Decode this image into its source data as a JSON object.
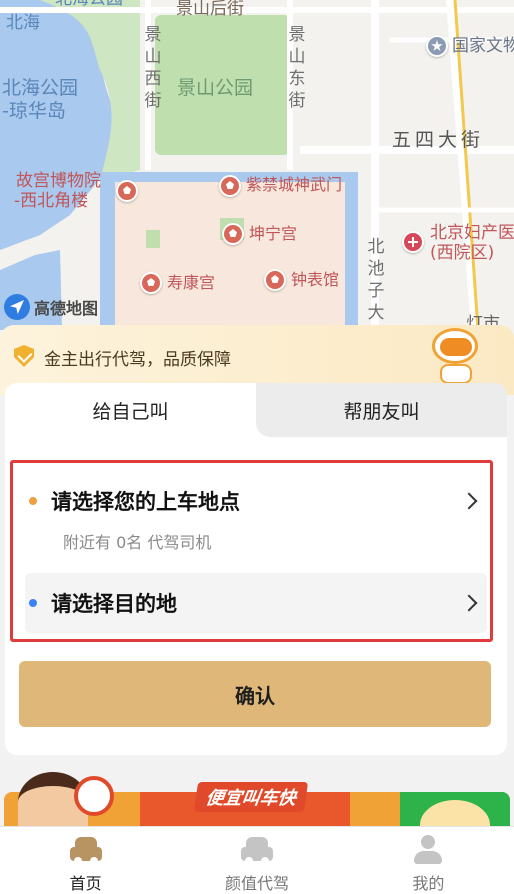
{
  "map": {
    "labels": {
      "beihai_top": "北海公园",
      "beihai": "北海",
      "jingshan_back_street": "景山后街",
      "jingshan_park": "景山公园",
      "beihai_park": "北海公园",
      "qionghua_island": "-琼华岛",
      "national_culture": "国家文物",
      "wusi_street": "五四大街",
      "palace_museum": "故宫博物院",
      "northwest_tower": "-西北角楼",
      "shenwu_gate": "紫禁城神武门",
      "kunning_palace": "坤宁宫",
      "shoukang_palace": "寿康宫",
      "clock_hall": "钟表馆",
      "hospital_line1": "北京妇产医",
      "hospital_line2": "(西院区)",
      "jingshan_west_street": "景山西街",
      "jingshan_east_street": "景山东街",
      "beichizi": "北池子大",
      "dengshi": "灯市"
    },
    "provider": "高德地图"
  },
  "banner": {
    "text": "金主出行代驾，品质保障"
  },
  "tabs": [
    {
      "label": "给自己叫",
      "active": true
    },
    {
      "label": "帮朋友叫",
      "active": false
    }
  ],
  "pickup": {
    "label": "请选择您的上车地点",
    "nearby": "附近有  0名  代驾司机",
    "dot_color": "#f0a040"
  },
  "destination": {
    "label": "请选择目的地",
    "dot_color": "#3b82f6"
  },
  "confirm_label": "确认",
  "promo": {
    "tag": "便宜叫车快"
  },
  "nav": [
    {
      "label": "首页",
      "icon": "car-icon",
      "active": true
    },
    {
      "label": "颜值代驾",
      "icon": "car-icon",
      "active": false
    },
    {
      "label": "我的",
      "icon": "user-icon",
      "active": false
    }
  ],
  "colors": {
    "accent": "#dfb879",
    "highlight_border": "#e03b3b"
  }
}
